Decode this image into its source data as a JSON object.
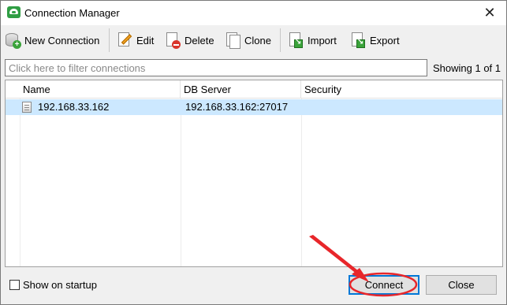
{
  "window": {
    "title": "Connection Manager",
    "close_glyph": "✕",
    "icon": "app-logo-icon"
  },
  "toolbar": {
    "new_connection": "New Connection",
    "edit": "Edit",
    "delete": "Delete",
    "clone": "Clone",
    "import": "Import",
    "export": "Export"
  },
  "filter": {
    "placeholder": "Click here to filter connections",
    "value": "",
    "showing": "Showing 1 of 1"
  },
  "grid": {
    "columns": [
      "Name",
      "DB Server",
      "Security"
    ],
    "rows": [
      {
        "name": "192.168.33.162",
        "db_server": "192.168.33.162:27017",
        "security": "",
        "selected": true
      }
    ]
  },
  "footer": {
    "show_on_startup_label": "Show on startup",
    "show_on_startup_checked": false,
    "connect_label": "Connect",
    "close_label": "Close"
  },
  "colors": {
    "selection": "#cce8ff",
    "annotation": "#e8262a",
    "focus_border": "#0078d7"
  }
}
